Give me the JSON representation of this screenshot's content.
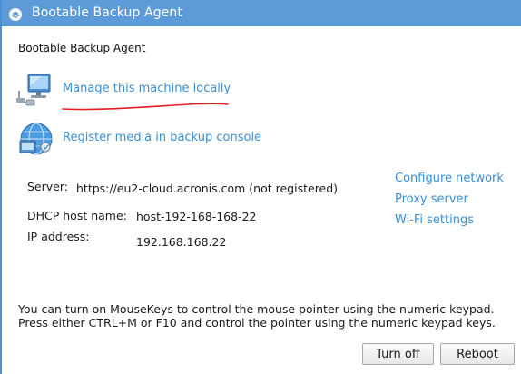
{
  "window": {
    "title": "Bootable Backup Agent",
    "accent_color": "#5d9ad8",
    "link_color": "#3a8fd6"
  },
  "header": {
    "label": "Bootable Backup Agent"
  },
  "actions": [
    {
      "icon": "computer-icon",
      "label": "Manage this machine locally"
    },
    {
      "icon": "network-globe-icon",
      "label": "Register media in backup console"
    }
  ],
  "info": {
    "server_label": "Server:",
    "server_value": "https://eu2-cloud.acronis.com (not registered)",
    "dhcp_label": "DHCP host name:",
    "dhcp_value": "host-192-168-168-22",
    "ip_label": "IP address:",
    "ip_value": "192.168.168.22"
  },
  "side_links": [
    "Configure network",
    "Proxy server",
    "Wi-Fi settings"
  ],
  "notes": [
    "You can turn on MouseKeys to control the mouse pointer using the numeric keypad.",
    "Press either CTRL+M or F10 and control the pointer using the numeric keypad keys."
  ],
  "buttons": {
    "turn_off": "Turn off",
    "reboot": "Reboot"
  }
}
